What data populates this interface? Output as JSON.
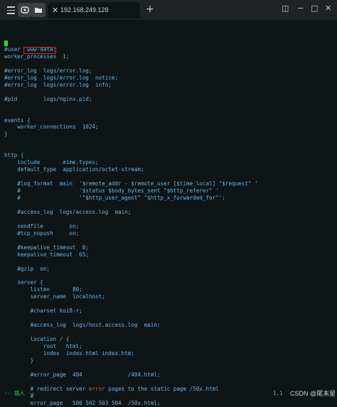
{
  "titlebar": {
    "menu_icon": "hamburger-icon",
    "tab_title": "192.168.249.128",
    "tab_close": "✕",
    "new_tab": "+",
    "sidebar_toggle": "◫",
    "minimize": "−",
    "maximize": "□",
    "close": "✕"
  },
  "editor": {
    "lines": [
      "#user  www-data;",
      "worker_processes  1;",
      "",
      "#error_log  logs/error.log;",
      "#error_log  logs/error.log  notice;",
      "#error_log  logs/error.log  info;",
      "",
      "#pid        logs/nginx.pid;",
      "",
      "",
      "events {",
      "    worker_connections  1024;",
      "}",
      "",
      "",
      "http {",
      "    include       mime.types;",
      "    default_type  application/octet-stream;",
      "",
      "    #log_format  main  '$remote_addr - $remote_user [$time_local] \"$request\" '",
      "    #                  '$status $body_bytes_sent \"$http_referer\" '",
      "    #                  '\"$http_user_agent\" \"$http_x_forwarded_for\"';",
      "",
      "    #access_log  logs/access.log  main;",
      "",
      "    sendfile        on;",
      "    #tcp_nopush     on;",
      "",
      "    #keepalive_timeout  0;",
      "    keepalive_timeout  65;",
      "",
      "    #gzip  on;",
      "",
      "    server {",
      "        listen       80;",
      "        server_name  localhost;",
      "",
      "        #charset koi8-r;",
      "",
      "        #access_log  logs/host.access.log  main;",
      "",
      "        location / {",
      "            root   html;",
      "            index  index.html index.htm;",
      "        }",
      "",
      "        #error_page  404              /404.html;",
      "",
      "        # redirect server error pages to the static page /50x.html",
      "        #",
      "        error_page   500 502 503 504  /50x.html;"
    ]
  },
  "status": {
    "mode": "-- 插入 --",
    "position": "1,1"
  },
  "watermark": "CSDN @尾末星",
  "colors": {
    "background": "#0d1517",
    "text": "#6fb4e6",
    "cursor": "#33d13e",
    "highlight_box": "#e02424"
  }
}
